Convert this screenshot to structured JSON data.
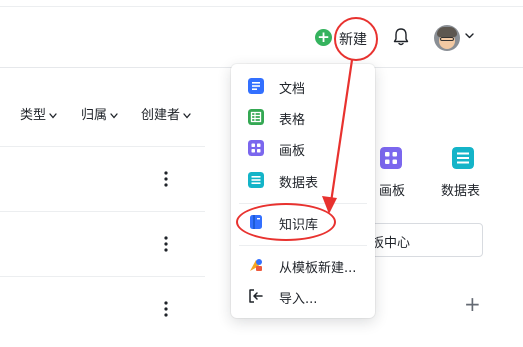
{
  "header": {
    "new_button_label": "新建",
    "plus_symbol": "+"
  },
  "filters": [
    {
      "label": "类型"
    },
    {
      "label": "归属"
    },
    {
      "label": "创建者"
    }
  ],
  "new_menu": {
    "items": [
      {
        "label": "文档",
        "icon": "doc-icon",
        "color": "#3370ff"
      },
      {
        "label": "表格",
        "icon": "sheet-icon",
        "color": "#34a853"
      },
      {
        "label": "画板",
        "icon": "whiteboard-icon",
        "color": "#7b67ee"
      },
      {
        "label": "数据表",
        "icon": "bitable-icon",
        "color": "#14b4c8"
      },
      {
        "label": "知识库",
        "icon": "wiki-icon",
        "color": "#3370ff",
        "highlighted": true
      },
      {
        "label": "从模板新建...",
        "icon": "template-icon",
        "color": "#f5a623"
      },
      {
        "label": "导入...",
        "icon": "import-icon",
        "color": "#1f2329"
      }
    ]
  },
  "template_panel": {
    "items": [
      {
        "label": "画板",
        "icon": "whiteboard-icon",
        "color": "#7b67ee"
      },
      {
        "label": "数据表",
        "icon": "bitable-icon",
        "color": "#14b4c8"
      }
    ],
    "search_text": "板中心",
    "add_symbol": "+"
  },
  "colors": {
    "annotation_red": "#e8322f",
    "new_button_green": "#35b35e"
  }
}
